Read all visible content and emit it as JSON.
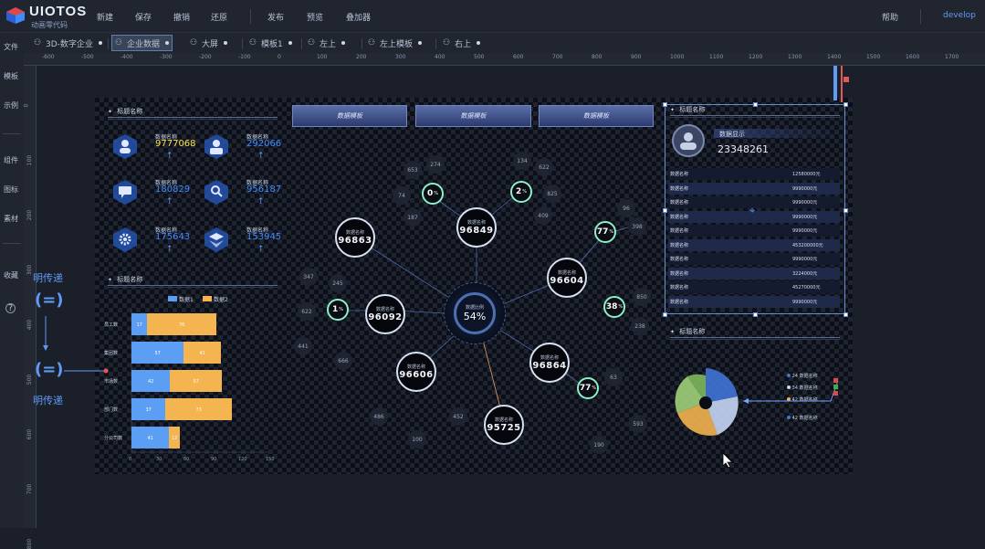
{
  "app": {
    "logo_name": "UIOTOS",
    "logo_sub": "动画零代码"
  },
  "toolbar": {
    "new": "新建",
    "save": "保存",
    "undo": "撤销",
    "redo": "还原",
    "publish": "发布",
    "preview": "预览",
    "overlay": "叠加器",
    "help": "帮助",
    "user": "develop"
  },
  "tabs": [
    {
      "label": "3D-数字企业"
    },
    {
      "label": "企业数据"
    },
    {
      "label": "大屏"
    },
    {
      "label": "模板1"
    },
    {
      "label": "左上"
    },
    {
      "label": "左上模板"
    },
    {
      "label": "右上"
    }
  ],
  "leftnav": [
    "文件",
    "模板",
    "示例",
    "组件",
    "图标",
    "素材",
    "收藏"
  ],
  "ruler": {
    "h": [
      "-600",
      "-500",
      "-400",
      "-300",
      "-200",
      "-100",
      "0",
      "100",
      "200",
      "300",
      "400",
      "500",
      "600",
      "700",
      "800",
      "900",
      "1000",
      "1100",
      "1200",
      "1300",
      "1400",
      "1500",
      "1600",
      "1700"
    ],
    "v": [
      "0",
      "100",
      "200",
      "300",
      "400",
      "500",
      "600",
      "700",
      "800"
    ]
  },
  "annotations": {
    "top": "明传递",
    "bottom": "明传递"
  },
  "screen": {
    "left_title_1": "标题名称",
    "left_title_2": "标题名称",
    "right_title_1": "标题名称",
    "right_title_2": "标题名称",
    "header_buttons": [
      "数据模板",
      "数据模板",
      "数据模板"
    ],
    "stats": [
      {
        "label": "数据名称",
        "value": "9777068",
        "highlight": true
      },
      {
        "label": "数据名称",
        "value": "292066",
        "highlight": false
      },
      {
        "label": "数据名称",
        "value": "180829",
        "highlight": false
      },
      {
        "label": "数据名称",
        "value": "956187",
        "highlight": false
      },
      {
        "label": "数据名称",
        "value": "175643",
        "highlight": false
      },
      {
        "label": "数据名称",
        "value": "153945",
        "highlight": false
      }
    ],
    "profile": {
      "name": "数据显示",
      "value": "23348261"
    },
    "table_rows": [
      {
        "label": "数据名称",
        "value": "12580000元"
      },
      {
        "label": "数据名称",
        "value": "9990000元"
      },
      {
        "label": "数据名称",
        "value": "9990000元"
      },
      {
        "label": "数据名称",
        "value": "9990000元"
      },
      {
        "label": "数据名称",
        "value": "9990000元"
      },
      {
        "label": "数据名称",
        "value": "453200000元"
      },
      {
        "label": "数据名称",
        "value": "9990000元"
      },
      {
        "label": "数据名称",
        "value": "3224000元"
      },
      {
        "label": "数据名称",
        "value": "45270000元"
      },
      {
        "label": "数据名称",
        "value": "9990000元"
      }
    ],
    "center": {
      "label": "数据比例",
      "value": "54%"
    },
    "nodes": [
      {
        "label": "数据名称",
        "value": "96863"
      },
      {
        "label": "数据名称",
        "value": "96849"
      },
      {
        "label": "数据名称",
        "value": "96604"
      },
      {
        "label": "数据名称",
        "value": "96092"
      },
      {
        "label": "数据名称",
        "value": "96606"
      },
      {
        "label": "数据名称",
        "value": "96864"
      },
      {
        "label": "数据名称",
        "value": "95725"
      }
    ],
    "rings": [
      {
        "value": "0",
        "unit": "%"
      },
      {
        "value": "2",
        "unit": "%"
      },
      {
        "value": "77",
        "unit": "%"
      },
      {
        "value": "1",
        "unit": "%"
      },
      {
        "value": "38",
        "unit": "%"
      },
      {
        "value": "77",
        "unit": "%"
      }
    ],
    "bubbles": [
      "653",
      "274",
      "134",
      "622",
      "74",
      "187",
      "825",
      "409",
      "96",
      "398",
      "347",
      "245",
      "622",
      "850",
      "441",
      "666",
      "238",
      "486",
      "452",
      "63",
      "100",
      "593",
      "190"
    ],
    "pie_legend": [
      "24",
      "34",
      "42",
      "42"
    ],
    "pie_legend_label": "数据名称"
  },
  "chart_data": {
    "type": "bar",
    "orientation": "horizontal",
    "stacked": true,
    "categories": [
      "员工数",
      "集团数",
      "市场数",
      "部门数",
      "分公司数"
    ],
    "series": [
      {
        "name": "数据1",
        "color": "#5b9ef4",
        "values": [
          17,
          57,
          42,
          37,
          41
        ]
      },
      {
        "name": "数据2",
        "color": "#f4b450",
        "values": [
          76,
          41,
          57,
          73,
          12
        ]
      }
    ],
    "x_ticks": [
      "0",
      "30",
      "60",
      "90",
      "120",
      "150"
    ],
    "xlim": [
      0,
      150
    ],
    "legend": "top"
  },
  "colors": {
    "accent": "#3f8cff",
    "highlight": "#ffe14a",
    "ring": "#8ef0c8",
    "canvas": "#0c0f18"
  }
}
